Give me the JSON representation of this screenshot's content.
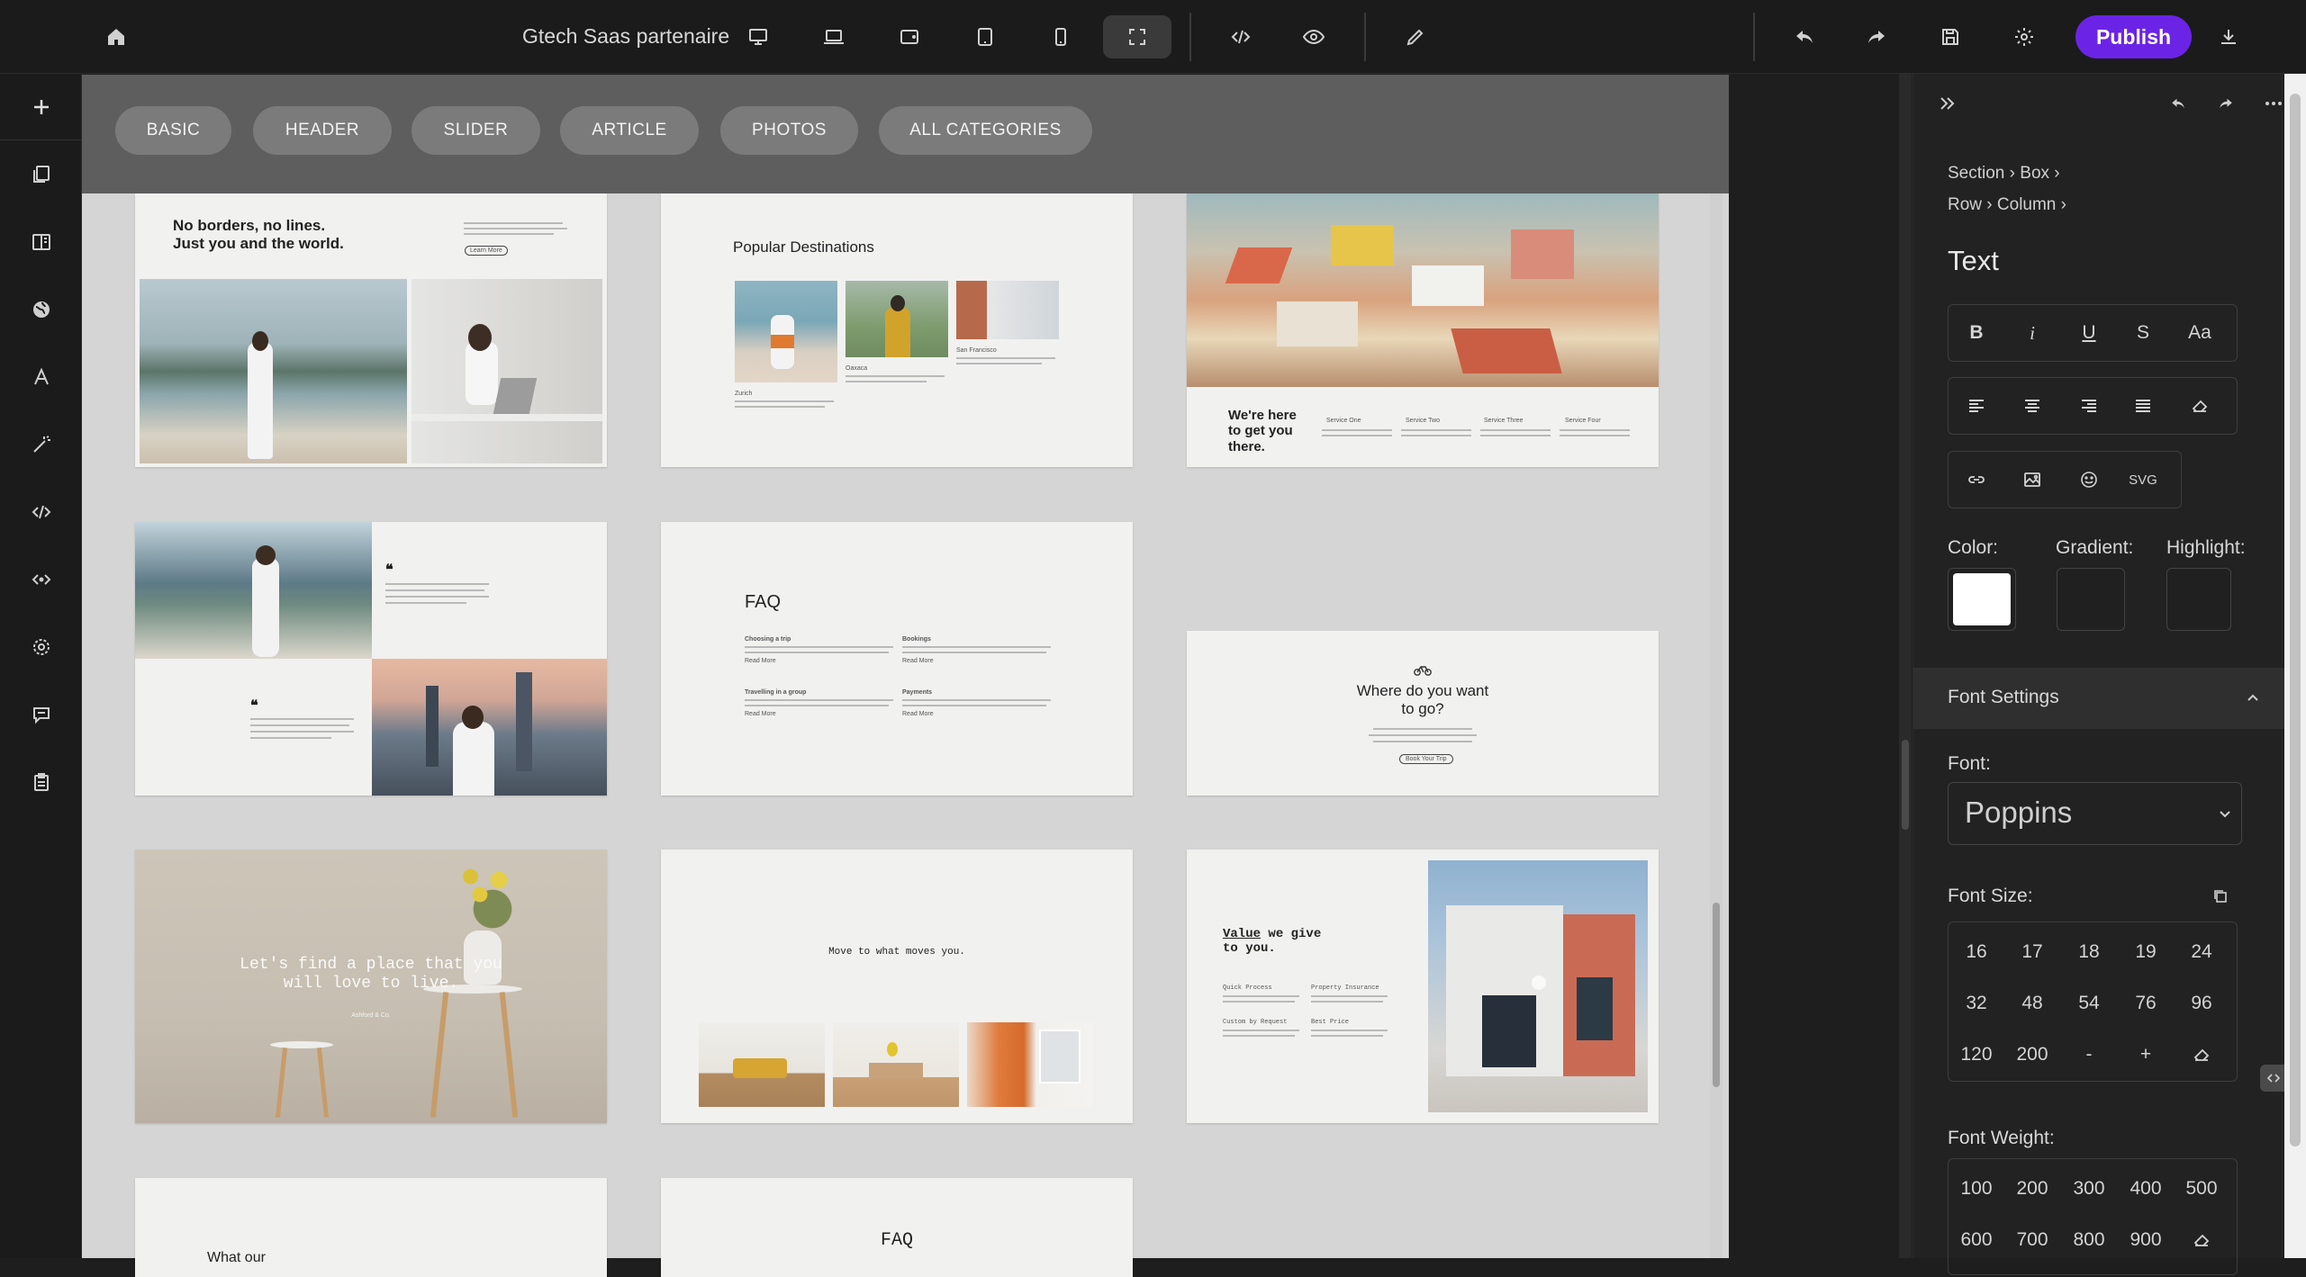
{
  "topbar": {
    "site_name": "Gtech Saas partenaire",
    "publish_label": "Publish"
  },
  "library": {
    "categories": [
      "BASIC",
      "HEADER",
      "SLIDER",
      "ARTICLE",
      "PHOTOS",
      "ALL CATEGORIES"
    ],
    "thumbs": {
      "t1_title": "No borders, no lines.\nJust you and the world.",
      "t1_btn": "Learn More",
      "t2_title": "Popular Destinations",
      "t2_cap1": "Zurich",
      "t2_cap2": "Oaxaca",
      "t2_cap3": "San Francisco",
      "t3_title": "We're here\nto get you\nthere.",
      "t3_services": [
        "Service One",
        "Service Two",
        "Service Three",
        "Service Four"
      ],
      "t5_title": "FAQ",
      "t5_q1": "Choosing a trip",
      "t5_q2": "Bookings",
      "t5_q3": "Travelling in a group",
      "t5_q4": "Payments",
      "t5_read": "Read More",
      "t6_title": "Where do you want\nto go?",
      "t6_btn": "Book Your Trip",
      "t7_title": "Let's find a place that you\nwill love to live.",
      "t7_sub": "Ashford & Co.",
      "t8_title": "Move to what moves you.",
      "t9_title_u": "Value",
      "t9_title_rest": " we give\nto you.",
      "t9_items": [
        "Quick Process",
        "Property Insurance",
        "Custom by Request",
        "Best Price"
      ],
      "t10_title": "What our",
      "t11_title": "FAQ"
    }
  },
  "panel": {
    "breadcrumb": [
      "Section",
      "Box",
      "Row",
      "Column"
    ],
    "title": "Text",
    "format_buttons": [
      "B",
      "i",
      "U",
      "S",
      "Aa"
    ],
    "insert_svg": "SVG",
    "color_label": "Color:",
    "gradient_label": "Gradient:",
    "highlight_label": "Highlight:",
    "color_value": "#ffffff",
    "font_settings_label": "Font Settings",
    "font_label": "Font:",
    "font_value": "Poppins",
    "font_size_label": "Font Size:",
    "sizes": [
      "16",
      "17",
      "18",
      "19",
      "24",
      "32",
      "48",
      "54",
      "76",
      "96",
      "120",
      "200",
      "-",
      "+"
    ],
    "font_weight_label": "Font Weight:",
    "weights": [
      "100",
      "200",
      "300",
      "400",
      "500",
      "600",
      "700",
      "800",
      "900"
    ]
  }
}
